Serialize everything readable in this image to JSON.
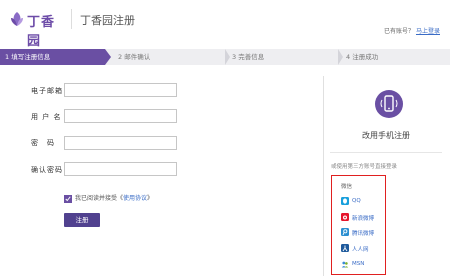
{
  "header": {
    "logo_text": "丁香园",
    "page_title": "丁香园注册",
    "login_prompt": "已有账号？",
    "login_link": "马上登录"
  },
  "steps": [
    {
      "label": "1 填写注册信息",
      "active": true
    },
    {
      "label": "2 邮件确认",
      "active": false
    },
    {
      "label": "3 完善信息",
      "active": false
    },
    {
      "label": "4 注册成功",
      "active": false
    }
  ],
  "form": {
    "email_label": "电子邮箱",
    "username_label": "用 户 名",
    "password_label": "密　码",
    "confirm_label": "确认密码",
    "email_value": "",
    "username_value": "",
    "password_value": "",
    "confirm_value": "",
    "agree_text": "我已阅读并接受《",
    "agree_link": "使用协议",
    "agree_tail": "》",
    "agree_checked": true,
    "submit_label": "注册"
  },
  "right": {
    "mobile_label": "改用手机注册",
    "third_party_tip": "或使用第三方账号直接登录",
    "social": [
      {
        "name": "微信",
        "icon": "wechat-icon",
        "color": "#7bb32e"
      },
      {
        "name": "QQ",
        "icon": "qq-icon",
        "color": "#1aa0dc"
      },
      {
        "name": "新浪微博",
        "icon": "weibo-icon",
        "color": "#e6162d"
      },
      {
        "name": "腾讯微博",
        "icon": "tencent-weibo-icon",
        "color": "#2b8fd1"
      },
      {
        "name": "人人网",
        "icon": "renren-icon",
        "color": "#1e5a9c"
      },
      {
        "name": "MSN",
        "icon": "msn-icon",
        "color": "#3a8ad6"
      }
    ]
  },
  "colors": {
    "brand": "#6a4fa3",
    "button": "#51418f",
    "link": "#3a6cc6",
    "highlight": "#e02020"
  }
}
